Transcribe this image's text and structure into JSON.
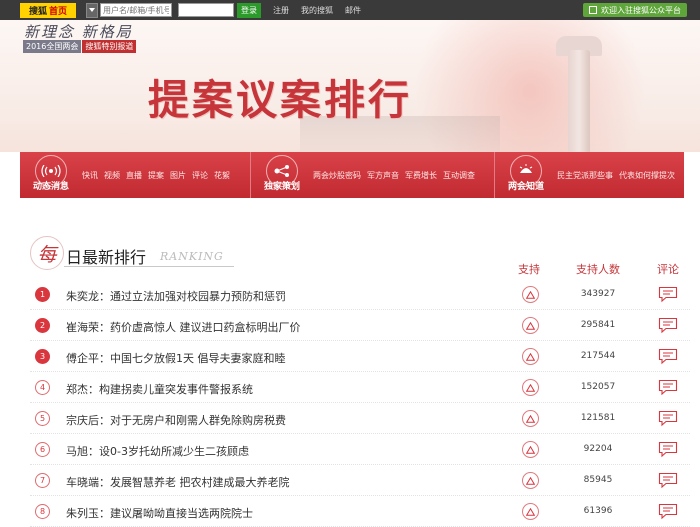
{
  "topbar": {
    "logo_brand": "搜狐",
    "logo_home": "首页",
    "username_placeholder": "用户名/邮箱/手机号",
    "login_label": "登录",
    "links": [
      "注册",
      "我的搜狐",
      "邮件"
    ],
    "welcome_label": "欢迎入驻搜狐公众平台"
  },
  "banner": {
    "slogan": "新理念 新格局",
    "tag_a": "2016全国两会",
    "tag_b": "搜狐特别报道",
    "title": "提案议案排行"
  },
  "nav": [
    {
      "title": "动态消息",
      "icon": "broadcast-icon",
      "links": [
        "快讯",
        "视频",
        "直播",
        "提案",
        "图片",
        "评论",
        "花絮"
      ]
    },
    {
      "title": "独家策划",
      "icon": "network-icon",
      "links": [
        "两会炒股密码",
        "军方声音",
        "军费增长",
        "互动调查"
      ]
    },
    {
      "title": "两会知道",
      "icon": "bulb-icon",
      "links": [
        "民主党派那些事",
        "代表如何撑提次"
      ]
    }
  ],
  "ranking": {
    "mei": "每",
    "title": "日最新排行",
    "english": "RANKING",
    "col_support": "支持",
    "col_count": "支持人数",
    "col_comment": "评论",
    "rows": [
      {
        "rank": "1",
        "title": "朱奕龙：通过立法加强对校园暴力预防和惩罚",
        "count": "343927"
      },
      {
        "rank": "2",
        "title": "崔海荣：药价虚高惊人 建议进口药盒标明出厂价",
        "count": "295841"
      },
      {
        "rank": "3",
        "title": "傅企平：中国七夕放假1天 倡导夫妻家庭和睦",
        "count": "217544"
      },
      {
        "rank": "4",
        "title": "郑杰：构建拐卖儿童突发事件警报系统",
        "count": "152057"
      },
      {
        "rank": "5",
        "title": "宗庆后：对于无房户和刚需人群免除购房税费",
        "count": "121581"
      },
      {
        "rank": "6",
        "title": "马旭：设0-3岁托幼所减少生二孩顾虑",
        "count": "92204"
      },
      {
        "rank": "7",
        "title": "车晓端：发展智慧养老 把农村建成最大养老院",
        "count": "85945"
      },
      {
        "rank": "8",
        "title": "朱列玉：建议屠呦呦直接当选两院院士",
        "count": "61396"
      }
    ]
  },
  "colors": {
    "accent": "#c6353a",
    "nav_red": "#d03a40",
    "green": "#2b9a2b"
  }
}
